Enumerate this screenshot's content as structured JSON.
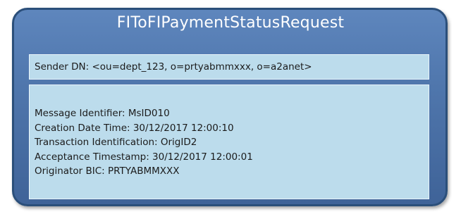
{
  "diagram": {
    "title": "FIToFIPaymentStatusRequest",
    "sender": "Sender DN: <ou=dept_123, o=prtyabmmxxx, o=a2anet>",
    "fields": [
      "Message Identifier: MsID010",
      "Creation Date Time: 30/12/2017 12:00:10",
      "Transaction Identification: OrigID2",
      "Acceptance Timestamp: 30/12/2017 12:00:01",
      "Originator BIC: PRTYABMMXXX"
    ]
  }
}
